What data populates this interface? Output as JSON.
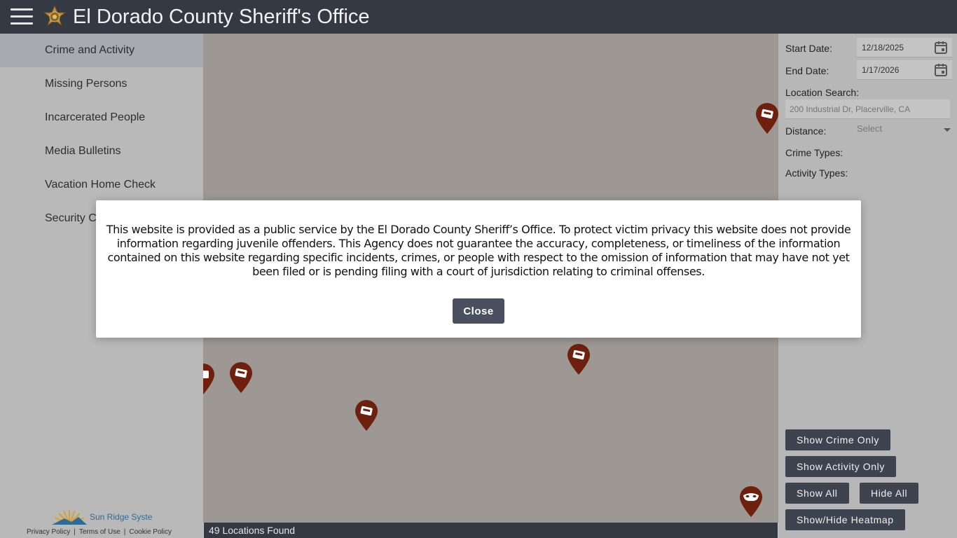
{
  "header": {
    "title": "El Dorado County Sheriff's Office",
    "menu_icon": "hamburger-icon",
    "badge_icon": "sheriff-star-badge"
  },
  "sidebar": {
    "items": [
      {
        "label": "Crime and Activity",
        "active": true
      },
      {
        "label": "Missing Persons"
      },
      {
        "label": "Incarcerated People"
      },
      {
        "label": "Media Bulletins"
      },
      {
        "label": "Vacation Home Check"
      },
      {
        "label": "Security C"
      }
    ],
    "footer": {
      "logo_text": "Sun Ridge Syste",
      "links": [
        "Privacy Policy",
        "Terms of Use",
        "Cookie Policy"
      ]
    }
  },
  "filters": {
    "start_date_label": "Start Date:",
    "start_date_value": "12/18/2025",
    "end_date_label": "End Date:",
    "end_date_value": "1/17/2026",
    "location_label": "Location Search:",
    "location_placeholder": "200 Industrial Dr, Placerville, CA",
    "distance_label": "Distance:",
    "distance_value": "Select",
    "crime_types_label": "Crime Types:",
    "activity_types_label": "Activity Types:"
  },
  "buttons": {
    "crime_only": "Show Crime Only",
    "activity_only": "Show Activity Only",
    "show_all": "Show All",
    "hide_all": "Hide All",
    "heatmap": "Show/Hide Heatmap"
  },
  "map": {
    "status": "49 Locations Found",
    "pin_color": "#6e1f0d"
  },
  "modal": {
    "text": "This website is provided as a public service by the El Dorado County Sheriff’s Office. To protect victim privacy this website does not provide information regarding juvenile offenders. This Agency does not guarantee the accuracy, completeness, or timeliness of the information contained on this website regarding specific incidents, crimes, or people with respect to the omission of information that may have not yet been filed or is pending filing with a court of jurisdiction relating to criminal offenses.",
    "close_label": "Close"
  }
}
